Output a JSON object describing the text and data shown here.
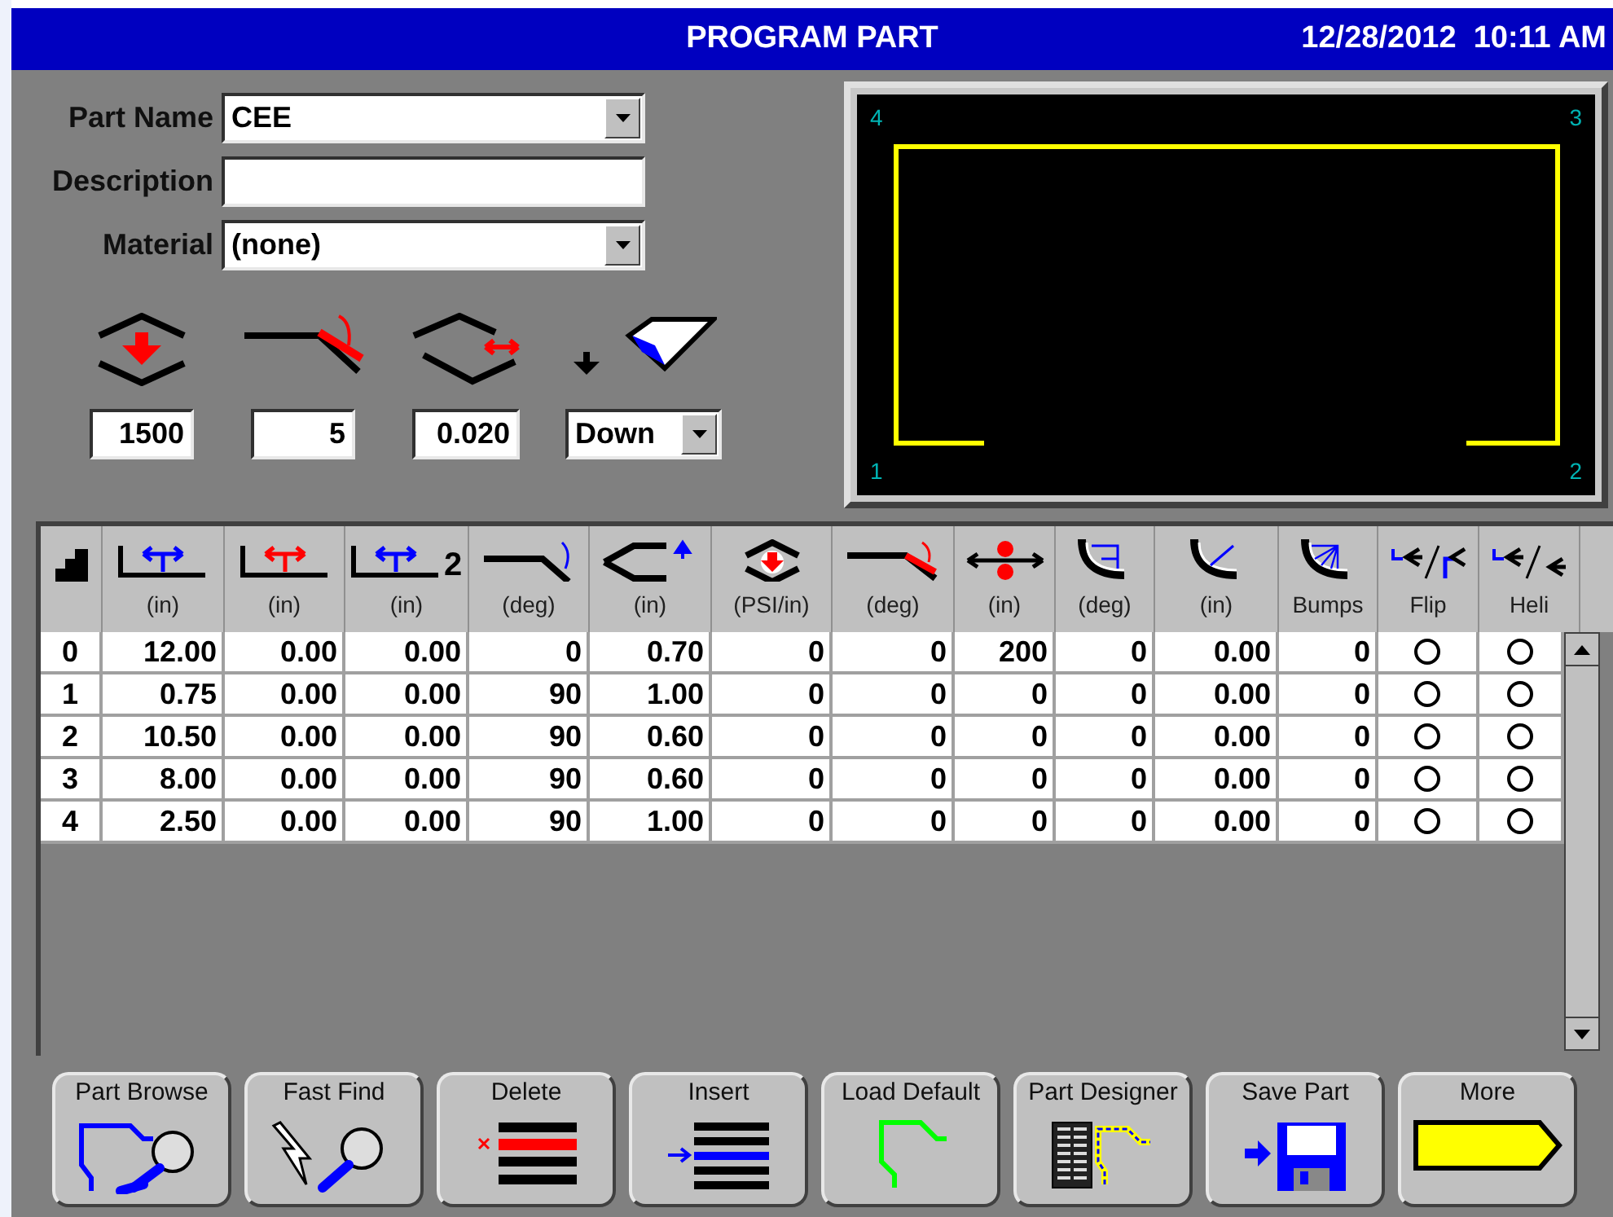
{
  "window": {
    "title": "PROGRAM PART",
    "datetime": "12/28/2012  10:11 AM"
  },
  "form": {
    "part_name": {
      "label": "Part Name",
      "value": "CEE"
    },
    "description": {
      "label": "Description"
    },
    "material": {
      "label": "Material",
      "value": "(none)"
    }
  },
  "settings": [
    {
      "kind": "field",
      "value": "1500"
    },
    {
      "kind": "field",
      "value": "5"
    },
    {
      "kind": "field",
      "value": "0.020"
    },
    {
      "kind": "dropdown",
      "value": "Down"
    }
  ],
  "preview": {
    "corners": [
      "4",
      "3",
      "1",
      "2"
    ]
  },
  "table": {
    "columns": [
      {
        "kind": "step"
      },
      {
        "kind": "x",
        "unit": "(in)"
      },
      {
        "kind": "r",
        "unit": "(in)"
      },
      {
        "kind": "x2",
        "unit": "(in)",
        "suffix": "2"
      },
      {
        "kind": "angle",
        "unit": "(deg)"
      },
      {
        "kind": "opening",
        "unit": "(in)"
      },
      {
        "kind": "tonnage",
        "unit": "(PSI/in)"
      },
      {
        "kind": "overbend",
        "unit": "(deg)"
      },
      {
        "kind": "rollers",
        "unit": "(in)"
      },
      {
        "kind": "radius",
        "unit": "(deg)"
      },
      {
        "kind": "deflection",
        "unit": "(in)"
      },
      {
        "kind": "bumps",
        "unit": "Bumps"
      },
      {
        "kind": "flip",
        "unit": "Flip"
      },
      {
        "kind": "heli",
        "unit": "Heli"
      }
    ],
    "rows": [
      {
        "index": "0",
        "values": [
          "12.00",
          "0.00",
          "0.00",
          "0",
          "0.70",
          "0",
          "0",
          "200",
          "0",
          "0.00",
          "0"
        ],
        "flip": false,
        "heli": false
      },
      {
        "index": "1",
        "values": [
          "0.75",
          "0.00",
          "0.00",
          "90",
          "1.00",
          "0",
          "0",
          "0",
          "0",
          "0.00",
          "0"
        ],
        "flip": false,
        "heli": false
      },
      {
        "index": "2",
        "values": [
          "10.50",
          "0.00",
          "0.00",
          "90",
          "0.60",
          "0",
          "0",
          "0",
          "0",
          "0.00",
          "0"
        ],
        "flip": false,
        "heli": false
      },
      {
        "index": "3",
        "values": [
          "8.00",
          "0.00",
          "0.00",
          "90",
          "0.60",
          "0",
          "0",
          "0",
          "0",
          "0.00",
          "0"
        ],
        "flip": false,
        "heli": false
      },
      {
        "index": "4",
        "values": [
          "2.50",
          "0.00",
          "0.00",
          "90",
          "1.00",
          "0",
          "0",
          "0",
          "0",
          "0.00",
          "0"
        ],
        "flip": false,
        "heli": false
      }
    ]
  },
  "buttons": [
    {
      "label": "Part Browse"
    },
    {
      "label": "Fast Find"
    },
    {
      "label": "Delete"
    },
    {
      "label": "Insert"
    },
    {
      "label": "Load Default"
    },
    {
      "label": "Part Designer"
    },
    {
      "label": "Save Part"
    },
    {
      "label": "More"
    }
  ]
}
